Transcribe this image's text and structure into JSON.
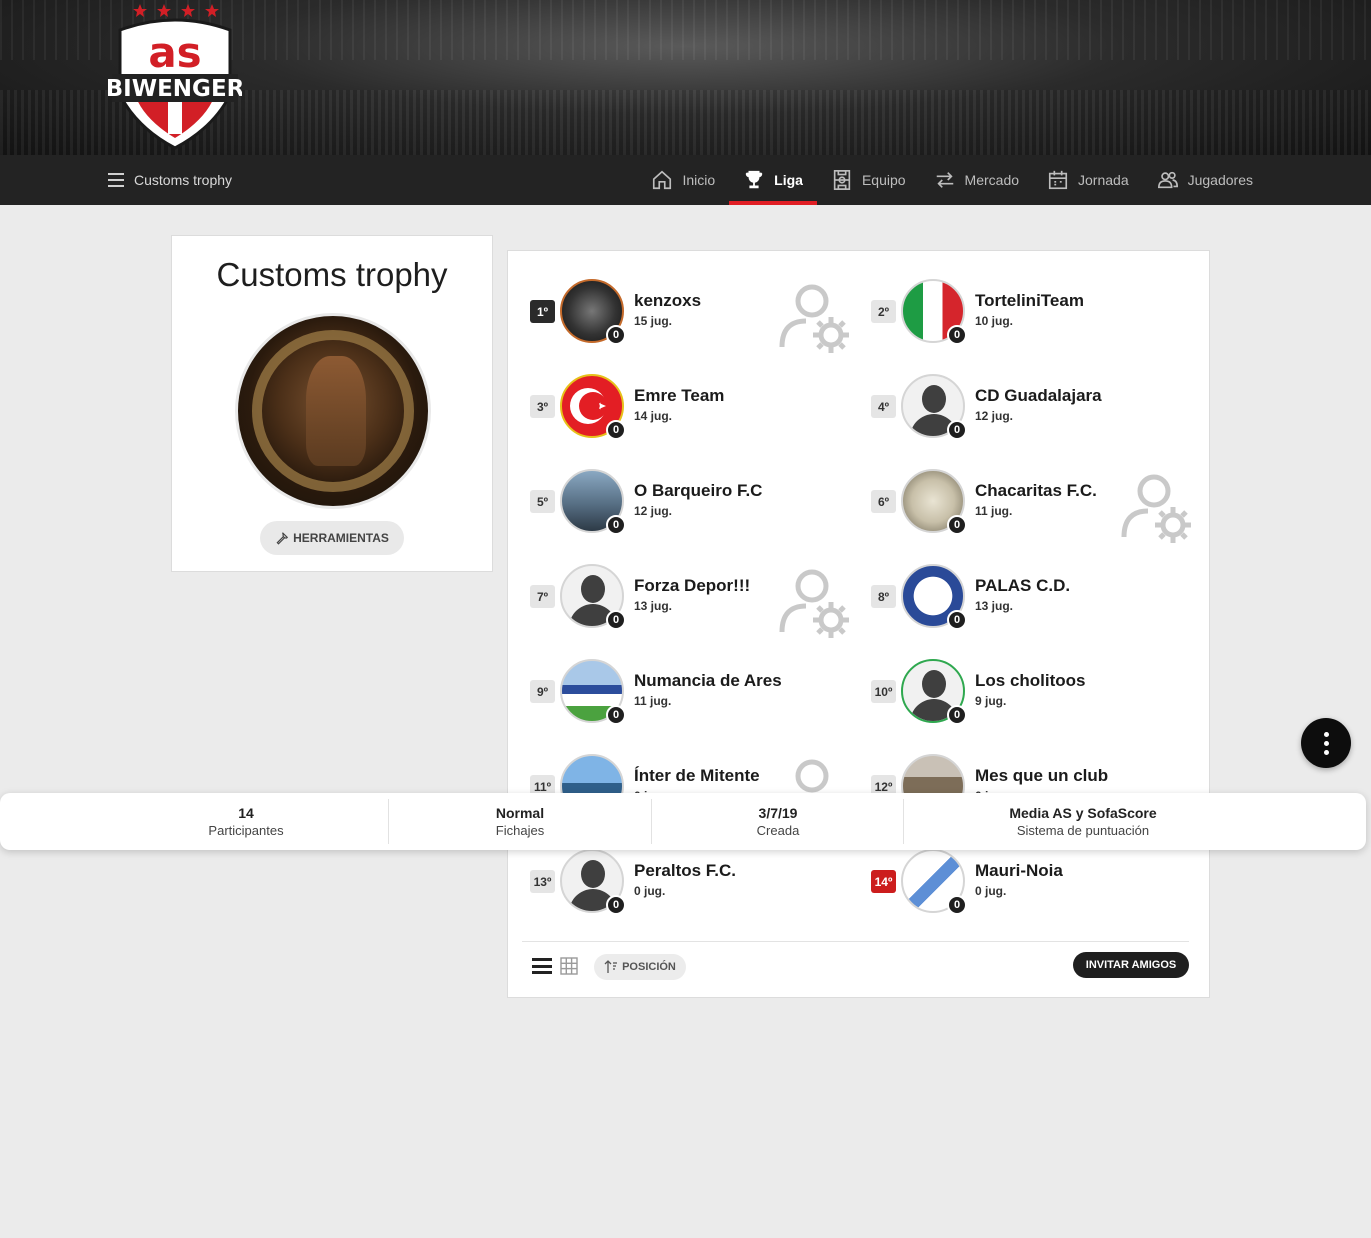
{
  "nav": {
    "menu_label": "Customs trophy",
    "items": [
      {
        "label": "Inicio",
        "icon": "home-icon"
      },
      {
        "label": "Liga",
        "icon": "trophy-icon"
      },
      {
        "label": "Equipo",
        "icon": "lineup-icon"
      },
      {
        "label": "Mercado",
        "icon": "transfer-icon"
      },
      {
        "label": "Jornada",
        "icon": "calendar-icon"
      },
      {
        "label": "Jugadores",
        "icon": "players-icon"
      }
    ],
    "active": "Liga",
    "accent_color": "#e01e24"
  },
  "logo": {
    "top": "as",
    "bottom": "BIWENGER"
  },
  "league": {
    "title": "Customs trophy",
    "tools_label": "HERRAMIENTAS"
  },
  "standings": [
    {
      "rank": "1º",
      "name": "kenzoxs",
      "players": "15 jug.",
      "points": "0"
    },
    {
      "rank": "2º",
      "name": "TorteliniTeam",
      "players": "10 jug.",
      "points": "0"
    },
    {
      "rank": "3º",
      "name": "Emre Team",
      "players": "14 jug.",
      "points": "0"
    },
    {
      "rank": "4º",
      "name": "CD Guadalajara",
      "players": "12 jug.",
      "points": "0"
    },
    {
      "rank": "5º",
      "name": "O Barqueiro F.C",
      "players": "12 jug.",
      "points": "0"
    },
    {
      "rank": "6º",
      "name": "Chacaritas F.C.",
      "players": "11 jug.",
      "points": "0"
    },
    {
      "rank": "7º",
      "name": "Forza Depor!!!",
      "players": "13 jug.",
      "points": "0"
    },
    {
      "rank": "8º",
      "name": "PALAS C.D.",
      "players": "13 jug.",
      "points": "0"
    },
    {
      "rank": "9º",
      "name": "Numancia de Ares",
      "players": "11 jug.",
      "points": "0"
    },
    {
      "rank": "10º",
      "name": "Los cholitoos",
      "players": "9 jug.",
      "points": "0"
    },
    {
      "rank": "11º",
      "name": "Ínter de Mitente",
      "players": "0 jug.",
      "points": "0"
    },
    {
      "rank": "12º",
      "name": "Mes que un club",
      "players": "0 jug.",
      "points": "0"
    },
    {
      "rank": "13º",
      "name": "Peraltos F.C.",
      "players": "0 jug.",
      "points": "0"
    },
    {
      "rank": "14º",
      "name": "Mauri-Noia",
      "players": "0 jug.",
      "points": "0"
    }
  ],
  "info": {
    "participants": {
      "value": "14",
      "label": "Participantes"
    },
    "transfers": {
      "value": "Normal",
      "label": "Fichajes"
    },
    "created": {
      "value": "3/7/19",
      "label": "Creada"
    },
    "scoring": {
      "value": "Media AS y SofaScore",
      "label": "Sistema de puntuación"
    }
  },
  "footer": {
    "sort_label": "POSICIÓN",
    "invite_label": "INVITAR AMIGOS"
  }
}
